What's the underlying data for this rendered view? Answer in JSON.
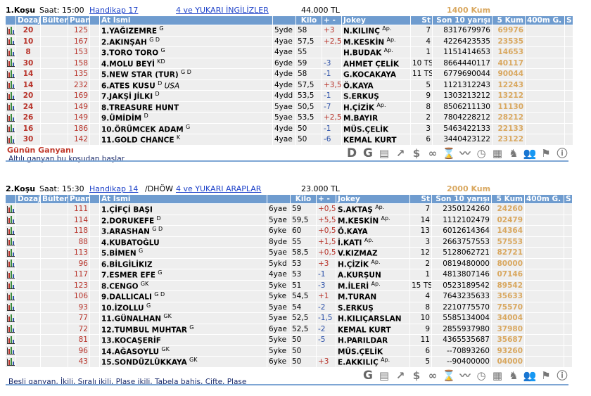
{
  "headers": {
    "dozaj": "Dozaj",
    "bulten": "Bülten",
    "puan": "Puan",
    "name": "At İsmi",
    "kilo": "Kilo",
    "pm": "+ -",
    "jockey": "Jokey",
    "st": "St",
    "son10": "Son 10 yarışı",
    "kum5": "5 Kum",
    "m400": "400m G.",
    "s": "S"
  },
  "races": [
    {
      "title": "1.Koşu",
      "time": "Saat: 15:00",
      "type": "Handikap  17",
      "type_suffix": "",
      "group": "4 ve YUKARI İNGİLİZLER",
      "prize": "44.000 TL",
      "distance": "1400 Kum",
      "footer_title": "Günün Ganyanı",
      "footer_note": "Altılı ganyan bu koşudan başlar",
      "icons": [
        "D-icon",
        "G-icon",
        "calculator-sheet-icon",
        "chart-arrow-icon",
        "dollar-icon",
        "binoculars-icon",
        "hourglass-icon",
        "line-chart-icon",
        "stopwatch-icon",
        "calculator-icon",
        "horse-head-icon",
        "people-icon",
        "checkered-flag-icon",
        "info-icon"
      ],
      "rows": [
        {
          "dozaj": "20",
          "bulten": "",
          "puan": "125",
          "name": "1.YAĞIZEMRE",
          "sup": "G",
          "origin": "",
          "age": "5yde",
          "kilo": "58",
          "pm": "+3",
          "jockey": "N.KILINÇ",
          "ap": "Ap.",
          "st": "7",
          "son10": "8317679976",
          "kum5": "69976"
        },
        {
          "dozaj": "10",
          "bulten": "",
          "puan": "167",
          "name": "2.AKINŞAH",
          "sup": "G D",
          "origin": "",
          "age": "4yae",
          "kilo": "57,5",
          "pm": "+2,5",
          "jockey": "M.KESKİN",
          "ap": "Ap.",
          "st": "4",
          "son10": "4226423535",
          "kum5": "23535"
        },
        {
          "dozaj": "8",
          "bulten": "",
          "puan": "153",
          "name": "3.TORO TORO",
          "sup": "G",
          "origin": "",
          "age": "4yae",
          "kilo": "55",
          "pm": "",
          "jockey": "H.BUDAK",
          "ap": "Ap.",
          "st": "1",
          "son10": "1151414653",
          "kum5": "14653"
        },
        {
          "dozaj": "30",
          "bulten": "",
          "puan": "158",
          "name": "4.MOLU BEYİ",
          "sup": "KD",
          "origin": "",
          "age": "6yde",
          "kilo": "59",
          "pm": "-3",
          "jockey": "AHMET ÇELİK",
          "ap": "",
          "st": "10 TS",
          "son10": "8664440117",
          "kum5": "40117"
        },
        {
          "dozaj": "14",
          "bulten": "",
          "puan": "135",
          "name": "5.NEW STAR (TUR)",
          "sup": "G D",
          "origin": "",
          "age": "4yde",
          "kilo": "58",
          "pm": "-1",
          "jockey": "G.KOCAKAYA",
          "ap": "",
          "st": "11 TS",
          "son10": "6779690044",
          "kum5": "90044"
        },
        {
          "dozaj": "14",
          "bulten": "",
          "puan": "232",
          "name": "6.ATES KUSU",
          "sup": "D",
          "origin": "USA",
          "age": "4yde",
          "kilo": "57,5",
          "pm": "+3,5",
          "jockey": "Ö.KAYA",
          "ap": "",
          "st": "5",
          "son10": "1121312243",
          "kum5": "12243"
        },
        {
          "dozaj": "20",
          "bulten": "",
          "puan": "169",
          "name": "7.JAKŞİ JİLKI",
          "sup": "D",
          "origin": "",
          "age": "4ydd",
          "kilo": "53,5",
          "pm": "-1",
          "jockey": "S.ERKUŞ",
          "ap": "",
          "st": "9",
          "son10": "1303213212",
          "kum5": "13212"
        },
        {
          "dozaj": "24",
          "bulten": "",
          "puan": "149",
          "name": "8.TREASURE HUNT",
          "sup": "",
          "origin": "",
          "age": "5yae",
          "kilo": "50,5",
          "pm": "-7",
          "jockey": "H.ÇİZİK",
          "ap": "Ap.",
          "st": "8",
          "son10": "8506211130",
          "kum5": "11130"
        },
        {
          "dozaj": "26",
          "bulten": "",
          "puan": "149",
          "name": "9.ÜMİDİM",
          "sup": "D",
          "origin": "",
          "age": "5yae",
          "kilo": "53,5",
          "pm": "+2,5",
          "jockey": "M.BAYIR",
          "ap": "",
          "st": "2",
          "son10": "7804228212",
          "kum5": "28212"
        },
        {
          "dozaj": "16",
          "bulten": "",
          "puan": "186",
          "name": "10.ÖRÜMCEK ADAM",
          "sup": "G",
          "origin": "",
          "age": "4yde",
          "kilo": "50",
          "pm": "-1",
          "jockey": "MÜS.ÇELİK",
          "ap": "",
          "st": "3",
          "son10": "5463422133",
          "kum5": "22133"
        },
        {
          "dozaj": "30",
          "bulten": "",
          "puan": "142",
          "name": "11.GOLD CHANCE",
          "sup": "K",
          "origin": "",
          "age": "4yae",
          "kilo": "50",
          "pm": "-6",
          "jockey": "KEMAL KURT",
          "ap": "",
          "st": "6",
          "son10": "3440423122",
          "kum5": "23122"
        }
      ]
    },
    {
      "title": "2.Koşu",
      "time": "Saat: 15:30",
      "type": "Handikap  14",
      "type_suffix": "/DHÖW",
      "group": "4 ve YUKARI ARAPLAR",
      "prize": "23.000 TL",
      "distance": "2000 Kum",
      "footer_title": "",
      "footer_note": "Beşli ganyan, İkili, Sıralı ikili, Plase ikili, Tabela bahis, Çifte, Plase",
      "icons": [
        "G-icon",
        "calculator-sheet-icon",
        "chart-arrow-icon",
        "dollar-icon",
        "binoculars-icon",
        "hourglass-icon",
        "line-chart-icon",
        "stopwatch-icon",
        "calculator-icon",
        "horse-head-icon",
        "people-icon",
        "checkered-flag-icon",
        "info-icon"
      ],
      "rows": [
        {
          "dozaj": "",
          "bulten": "",
          "puan": "111",
          "name": "1.ÇİFÇİ BAŞI",
          "sup": "",
          "origin": "",
          "age": "6yae",
          "kilo": "59",
          "pm": "+0,5",
          "jockey": "S.AKTAŞ",
          "ap": "Ap.",
          "st": "7",
          "son10": "2350124260",
          "kum5": "24260"
        },
        {
          "dozaj": "",
          "bulten": "",
          "puan": "114",
          "name": "2.DORUKEFE",
          "sup": "D",
          "origin": "",
          "age": "5yae",
          "kilo": "59,5",
          "pm": "+5,5",
          "jockey": "M.KESKİN",
          "ap": "Ap.",
          "st": "14",
          "son10": "1112102479",
          "kum5": "02479"
        },
        {
          "dozaj": "",
          "bulten": "",
          "puan": "118",
          "name": "3.ARASHAN",
          "sup": "G D",
          "origin": "",
          "age": "6yke",
          "kilo": "60",
          "pm": "+0,5",
          "jockey": "Ö.KAYA",
          "ap": "",
          "st": "13",
          "son10": "6012614364",
          "kum5": "14364"
        },
        {
          "dozaj": "",
          "bulten": "",
          "puan": "88",
          "name": "4.KUBATOĞLU",
          "sup": "",
          "origin": "",
          "age": "8yde",
          "kilo": "55",
          "pm": "+1,5",
          "jockey": "İ.KATI",
          "ap": "Ap.",
          "st": "3",
          "son10": "2663757553",
          "kum5": "57553"
        },
        {
          "dozaj": "",
          "bulten": "",
          "puan": "113",
          "name": "5.BİMEN",
          "sup": "G",
          "origin": "",
          "age": "5yae",
          "kilo": "58,5",
          "pm": "+0,5",
          "jockey": "V.KIZMAZ",
          "ap": "",
          "st": "12",
          "son10": "5128062721",
          "kum5": "82721"
        },
        {
          "dozaj": "",
          "bulten": "",
          "puan": "96",
          "name": "6.BİLGİLİKIZ",
          "sup": "",
          "origin": "",
          "age": "5ykd",
          "kilo": "53",
          "pm": "+3",
          "jockey": "H.ÇİZİK",
          "ap": "Ap.",
          "st": "2",
          "son10": "0819480000",
          "kum5": "80000"
        },
        {
          "dozaj": "",
          "bulten": "",
          "puan": "117",
          "name": "7.ESMER EFE",
          "sup": "G",
          "origin": "",
          "age": "4yae",
          "kilo": "53",
          "pm": "-1",
          "jockey": "A.KURŞUN",
          "ap": "",
          "st": "1",
          "son10": "4813807146",
          "kum5": "07146"
        },
        {
          "dozaj": "",
          "bulten": "",
          "puan": "123",
          "name": "8.CENGO",
          "sup": "GK",
          "origin": "",
          "age": "5yke",
          "kilo": "51",
          "pm": "-3",
          "jockey": "M.İLERİ",
          "ap": "Ap.",
          "st": "15 TS",
          "son10": "0523189542",
          "kum5": "89542"
        },
        {
          "dozaj": "",
          "bulten": "",
          "puan": "106",
          "name": "9.DALLICALI",
          "sup": "G D",
          "origin": "",
          "age": "5yke",
          "kilo": "54,5",
          "pm": "+1",
          "jockey": "M.TURAN",
          "ap": "",
          "st": "4",
          "son10": "7643235633",
          "kum5": "35633"
        },
        {
          "dozaj": "",
          "bulten": "",
          "puan": "93",
          "name": "10.İZOLLU",
          "sup": "G",
          "origin": "",
          "age": "5yae",
          "kilo": "54",
          "pm": "-2",
          "jockey": "S.ERKUŞ",
          "ap": "",
          "st": "8",
          "son10": "2210775570",
          "kum5": "75570"
        },
        {
          "dozaj": "",
          "bulten": "",
          "puan": "77",
          "name": "11.GÜNALHAN",
          "sup": "GK",
          "origin": "",
          "age": "5yae",
          "kilo": "52,5",
          "pm": "-1,5",
          "jockey": "H.KILIÇARSLAN",
          "ap": "",
          "st": "10",
          "son10": "5585134004",
          "kum5": "34004"
        },
        {
          "dozaj": "",
          "bulten": "",
          "puan": "72",
          "name": "12.TUMBUL MUHTAR",
          "sup": "G",
          "origin": "",
          "age": "6yae",
          "kilo": "52,5",
          "pm": "-2",
          "jockey": "KEMAL KURT",
          "ap": "",
          "st": "9",
          "son10": "2855937980",
          "kum5": "37980"
        },
        {
          "dozaj": "",
          "bulten": "",
          "puan": "81",
          "name": "13.KOCAŞERİF",
          "sup": "",
          "origin": "",
          "age": "5yke",
          "kilo": "50",
          "pm": "-5",
          "jockey": "H.PARILDAR",
          "ap": "",
          "st": "11",
          "son10": "4365535687",
          "kum5": "35687"
        },
        {
          "dozaj": "",
          "bulten": "",
          "puan": "96",
          "name": "14.AĞASOYLU",
          "sup": "GK",
          "origin": "",
          "age": "5yke",
          "kilo": "50",
          "pm": "",
          "jockey": "MÜS.ÇELİK",
          "ap": "",
          "st": "6",
          "son10": "--70893260",
          "kum5": "93260"
        },
        {
          "dozaj": "",
          "bulten": "",
          "puan": "43",
          "name": "15.SONDÜZLÜKKAYA",
          "sup": "GK",
          "origin": "",
          "age": "6yke",
          "kilo": "50",
          "pm": "+3",
          "jockey": "E.AKKILIÇ",
          "ap": "Ap.",
          "st": "5",
          "son10": "--90400000",
          "kum5": "04000"
        }
      ]
    }
  ],
  "colors": {
    "header": "#6f9ccf",
    "dozaj": "#b8332a",
    "plus": "#b8332a",
    "minus": "#2a4fa8",
    "kum": "#d9a860",
    "link": "#1a3fc8"
  }
}
